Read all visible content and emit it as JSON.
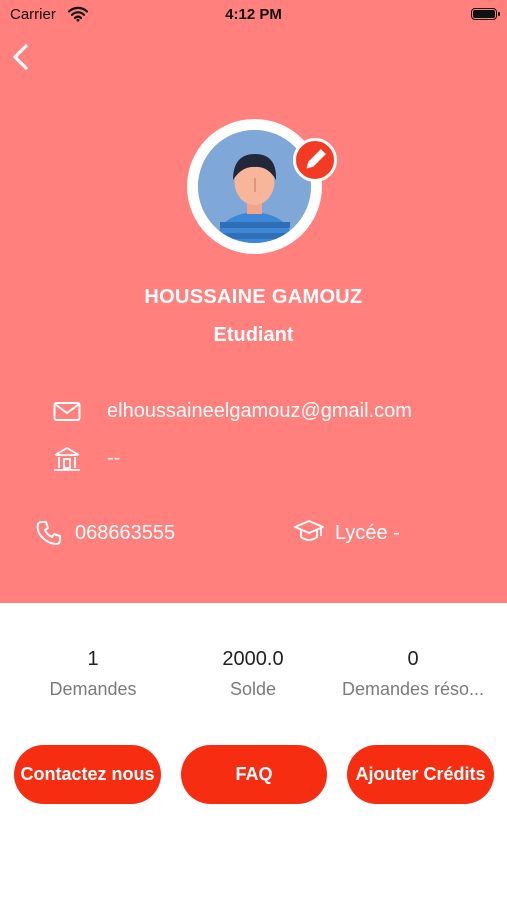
{
  "status_bar": {
    "carrier": "Carrier",
    "time": "4:12 PM"
  },
  "profile": {
    "name": "HOUSSAINE GAMOUZ",
    "role": "Etudiant",
    "email": "elhoussaineelgamouz@gmail.com",
    "school": "--",
    "phone": "068663555",
    "level": "Lycée -"
  },
  "stats": [
    {
      "value": "1",
      "label": "Demandes"
    },
    {
      "value": "2000.0",
      "label": "Solde"
    },
    {
      "value": "0",
      "label": "Demandes réso..."
    }
  ],
  "buttons": {
    "contact": "Contactez nous",
    "faq": "FAQ",
    "add_credits": "Ajouter Crédits"
  },
  "icons": {
    "back": "chevron-left-icon",
    "edit": "pencil-icon",
    "email": "envelope-icon",
    "school": "building-icon",
    "phone": "phone-icon",
    "level": "graduation-cap-icon"
  },
  "colors": {
    "header_bg": "#FF807C",
    "accent": "#F72D12",
    "edit_badge": "#F23B22"
  }
}
